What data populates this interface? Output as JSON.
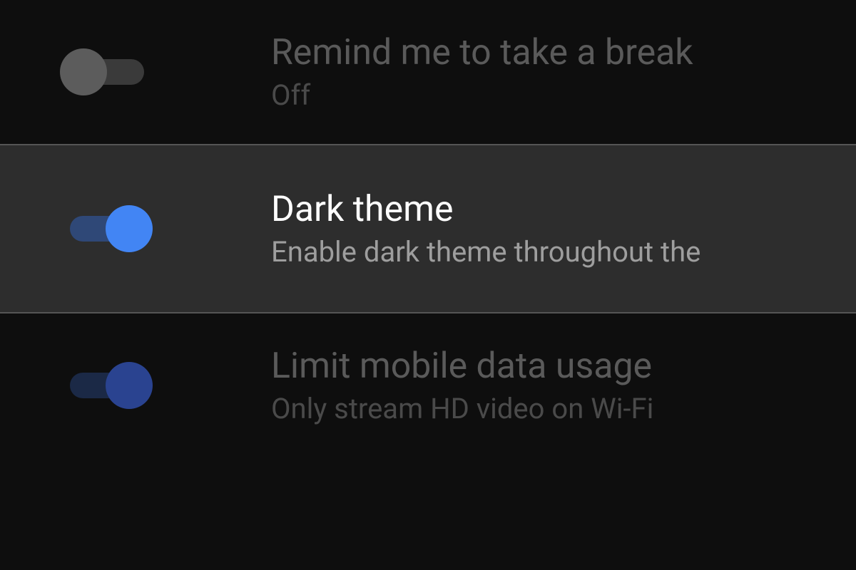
{
  "settings": [
    {
      "id": "remind-break",
      "title": "Remind me to take a break",
      "subtitle": "Off",
      "on": false,
      "highlighted": false,
      "dimmed": true,
      "toggle_variant": "grey"
    },
    {
      "id": "dark-theme",
      "title": "Dark theme",
      "subtitle": "Enable dark theme throughout the",
      "on": true,
      "highlighted": true,
      "dimmed": false,
      "toggle_variant": "blue"
    },
    {
      "id": "limit-data",
      "title": "Limit mobile data usage",
      "subtitle": "Only stream HD video on Wi-Fi",
      "on": true,
      "highlighted": false,
      "dimmed": true,
      "toggle_variant": "dimblue"
    }
  ],
  "colors": {
    "background": "#0e0e0e",
    "highlight_bg": "#2d2d2d",
    "accent_blue": "#4285f4"
  }
}
